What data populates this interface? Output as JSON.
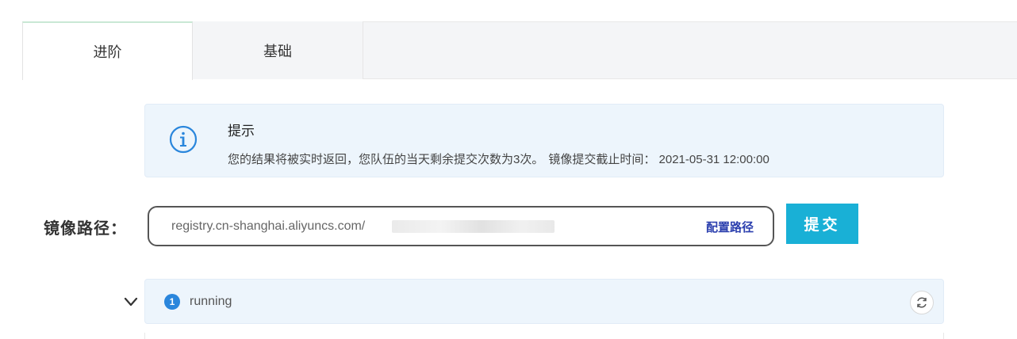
{
  "tabs": [
    {
      "label": "进阶",
      "active": true
    },
    {
      "label": "基础",
      "active": false
    }
  ],
  "tip": {
    "icon": "info-icon",
    "title": "提示",
    "message": "您的结果将被实时返回，您队伍的当天剩余提交次数为3次。",
    "deadline": "镜像提交截止时间： 2021-05-31 12:00:00"
  },
  "image_path": {
    "label": "镜像路径：",
    "value": "registry.cn-shanghai.aliyuncs.com/",
    "config_link": "配置路径",
    "submit_label": "提交"
  },
  "status": {
    "badge": "1",
    "text": "running",
    "expand_icon": "chevron-down-icon",
    "refresh_icon": "refresh-icon"
  },
  "colors": {
    "accent": "#19b0d6",
    "tip_bg": "#edf5fc",
    "info": "#2a86dc",
    "link": "#2b3fae"
  }
}
